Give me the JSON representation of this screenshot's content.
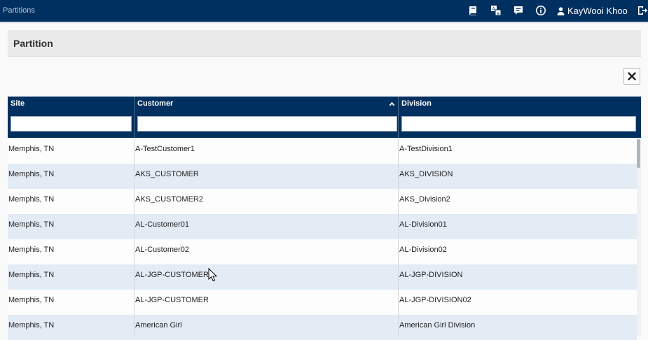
{
  "topbar": {
    "breadcrumb": "Partitions",
    "user_name": "KayWooi Khoo",
    "icons": [
      "book-icon",
      "translate-icon",
      "comment-icon",
      "info-icon",
      "user-icon",
      "logout-icon"
    ]
  },
  "panel": {
    "title": "Partition"
  },
  "grid": {
    "columns": [
      {
        "label": "Site",
        "filter_value": ""
      },
      {
        "label": "Customer",
        "filter_value": "",
        "sort": "ascending"
      },
      {
        "label": "Division",
        "filter_value": ""
      }
    ],
    "rows": [
      {
        "site": "Memphis, TN",
        "customer": "A-TestCustomer1",
        "division": "A-TestDivision1"
      },
      {
        "site": "Memphis, TN",
        "customer": "AKS_CUSTOMER",
        "division": "AKS_DIVISION"
      },
      {
        "site": "Memphis, TN",
        "customer": "AKS_CUSTOMER2",
        "division": "AKS_Division2"
      },
      {
        "site": "Memphis, TN",
        "customer": "AL-Customer01",
        "division": "AL-Division01"
      },
      {
        "site": "Memphis, TN",
        "customer": "AL-Customer02",
        "division": "AL-Division02"
      },
      {
        "site": "Memphis, TN",
        "customer": "AL-JGP-CUSTOMER",
        "division": "AL-JGP-DIVISION"
      },
      {
        "site": "Memphis, TN",
        "customer": "AL-JGP-CUSTOMER",
        "division": "AL-JGP-DIVISION02"
      },
      {
        "site": "Memphis, TN",
        "customer": "American Girl",
        "division": "American Girl Division"
      }
    ]
  },
  "colors": {
    "header_bg": "#00305f",
    "row_alt": "#e3ebf5",
    "panel_bg": "#eaeaea"
  }
}
